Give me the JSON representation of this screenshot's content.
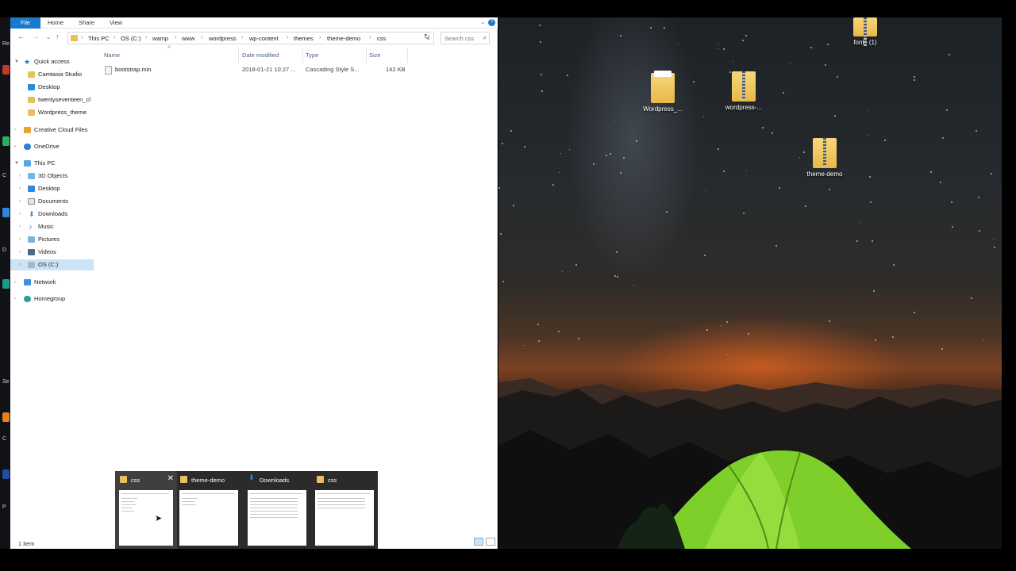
{
  "left_strip": {
    "labels": [
      "Re",
      "C",
      "D",
      "Se",
      "C",
      "P"
    ]
  },
  "explorer": {
    "ribbon": {
      "tabs": [
        "File",
        "Home",
        "Share",
        "View"
      ]
    },
    "address": {
      "crumbs": [
        "This PC",
        "OS (C:)",
        "wamp",
        "www",
        "wordpress",
        "wp-content",
        "themes",
        "theme-demo",
        "css"
      ],
      "search_placeholder": "Search css"
    },
    "nav": [
      {
        "label": "Quick access",
        "icon": "star-icon",
        "selected": false
      },
      {
        "label": "Camtasia Studio",
        "icon": "folder-icon",
        "selected": false
      },
      {
        "label": "Desktop",
        "icon": "desktop-icon",
        "selected": false
      },
      {
        "label": "twentyseventeen_cl",
        "icon": "folder-icon",
        "selected": false
      },
      {
        "label": "Wordpress_theme",
        "icon": "folder-icon",
        "selected": false
      },
      {
        "label": "Creative Cloud Files",
        "icon": "creative-cloud-icon",
        "selected": false
      },
      {
        "label": "OneDrive",
        "icon": "cloud-icon",
        "selected": false
      },
      {
        "label": "This PC",
        "icon": "computer-icon",
        "selected": false
      },
      {
        "label": "3D Objects",
        "icon": "cube-icon",
        "selected": false
      },
      {
        "label": "Desktop",
        "icon": "desktop-icon",
        "selected": false
      },
      {
        "label": "Documents",
        "icon": "documents-icon",
        "selected": false
      },
      {
        "label": "Downloads",
        "icon": "download-icon",
        "selected": false
      },
      {
        "label": "Music",
        "icon": "music-icon",
        "selected": false
      },
      {
        "label": "Pictures",
        "icon": "pictures-icon",
        "selected": false
      },
      {
        "label": "Videos",
        "icon": "videos-icon",
        "selected": false
      },
      {
        "label": "OS (C:)",
        "icon": "drive-icon",
        "selected": true
      },
      {
        "label": "Network",
        "icon": "network-icon",
        "selected": false
      },
      {
        "label": "Homegroup",
        "icon": "homegroup-icon",
        "selected": false
      }
    ],
    "columns": [
      "Name",
      "Date modified",
      "Type",
      "Size"
    ],
    "files": [
      {
        "name": "bootstrap.min",
        "date": "2018-01-21 10:27 ...",
        "type": "Cascading Style S...",
        "size": "142 KB"
      }
    ],
    "status": "1 item"
  },
  "desktop": {
    "icons": [
      {
        "label": "fonts (1)",
        "zip": true
      },
      {
        "label": "Wordpress_...",
        "zip": false
      },
      {
        "label": "wordpress-...",
        "zip": true
      },
      {
        "label": "theme-demo",
        "zip": true
      }
    ]
  },
  "thumbnails": [
    {
      "title": "css",
      "icon": "folder-icon",
      "active": true
    },
    {
      "title": "theme-demo",
      "icon": "folder-icon",
      "active": false
    },
    {
      "title": "Downloads",
      "icon": "download-icon",
      "active": false
    },
    {
      "title": "css",
      "icon": "folder-icon",
      "active": false
    }
  ],
  "colors": {
    "accent": "#1979ca",
    "selection": "#cce4f7",
    "folder": "#e8c15a",
    "tent": "#7fcf2a"
  }
}
